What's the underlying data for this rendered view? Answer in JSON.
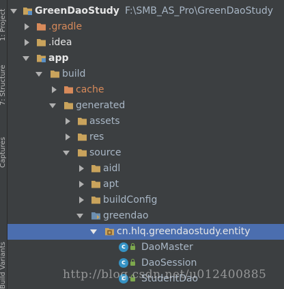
{
  "side_tabs": {
    "project": "1: Project",
    "structure": "7: Structure",
    "captures": "Captures",
    "variants": "Build Variants"
  },
  "tree": {
    "root": {
      "name": "GreenDaoStudy",
      "path": "F:\\SMB_AS_Pro\\GreenDaoStudy"
    },
    "gradle": ".gradle",
    "idea": ".idea",
    "app": "app",
    "build": "build",
    "cache": "cache",
    "generated": "generated",
    "assets": "assets",
    "res": "res",
    "source": "source",
    "aidl": "aidl",
    "apt": "apt",
    "buildConfig": "buildConfig",
    "greendao": "greendao",
    "package": "cn.hlq.greendaostudy.entity",
    "classes": [
      "DaoMaster",
      "DaoSession",
      "StudentDao"
    ]
  },
  "watermark": "http://blog.csdn.net/u012400885",
  "colors": {
    "background": "#3c3f41",
    "selection": "#4b6eaf",
    "folder": "#c9a35c",
    "excluded_folder": "#d88a5a",
    "class_icon": "#3592c4"
  }
}
